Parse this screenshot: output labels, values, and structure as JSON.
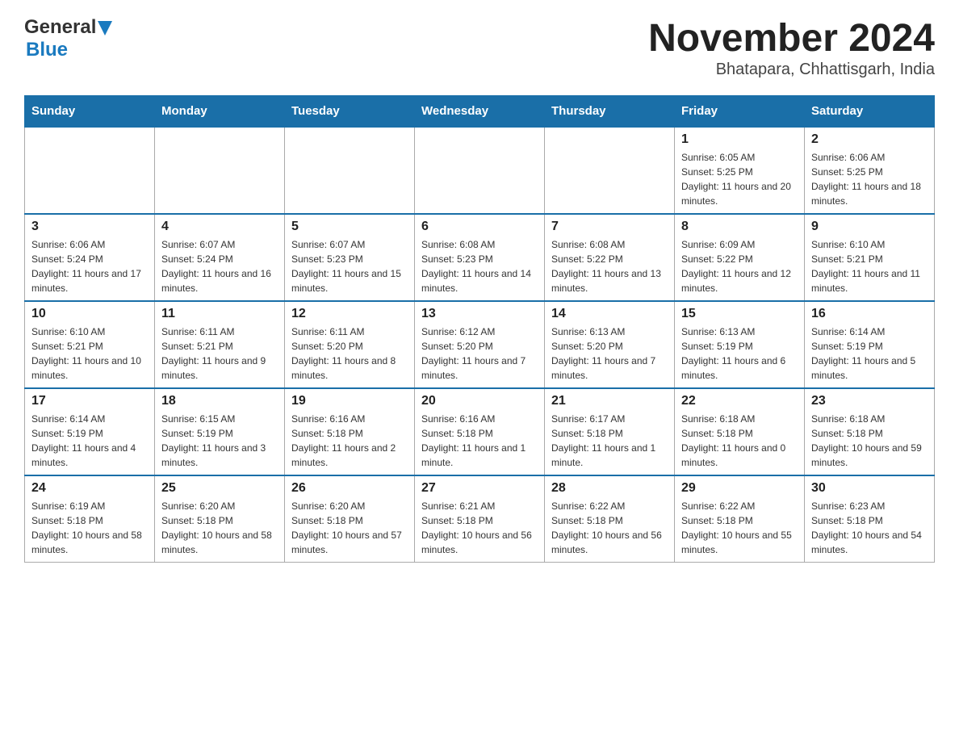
{
  "header": {
    "logo_general": "General",
    "logo_blue": "Blue",
    "month_title": "November 2024",
    "location": "Bhatapara, Chhattisgarh, India"
  },
  "days_of_week": [
    "Sunday",
    "Monday",
    "Tuesday",
    "Wednesday",
    "Thursday",
    "Friday",
    "Saturday"
  ],
  "weeks": [
    [
      {
        "day": "",
        "info": ""
      },
      {
        "day": "",
        "info": ""
      },
      {
        "day": "",
        "info": ""
      },
      {
        "day": "",
        "info": ""
      },
      {
        "day": "",
        "info": ""
      },
      {
        "day": "1",
        "info": "Sunrise: 6:05 AM\nSunset: 5:25 PM\nDaylight: 11 hours and 20 minutes."
      },
      {
        "day": "2",
        "info": "Sunrise: 6:06 AM\nSunset: 5:25 PM\nDaylight: 11 hours and 18 minutes."
      }
    ],
    [
      {
        "day": "3",
        "info": "Sunrise: 6:06 AM\nSunset: 5:24 PM\nDaylight: 11 hours and 17 minutes."
      },
      {
        "day": "4",
        "info": "Sunrise: 6:07 AM\nSunset: 5:24 PM\nDaylight: 11 hours and 16 minutes."
      },
      {
        "day": "5",
        "info": "Sunrise: 6:07 AM\nSunset: 5:23 PM\nDaylight: 11 hours and 15 minutes."
      },
      {
        "day": "6",
        "info": "Sunrise: 6:08 AM\nSunset: 5:23 PM\nDaylight: 11 hours and 14 minutes."
      },
      {
        "day": "7",
        "info": "Sunrise: 6:08 AM\nSunset: 5:22 PM\nDaylight: 11 hours and 13 minutes."
      },
      {
        "day": "8",
        "info": "Sunrise: 6:09 AM\nSunset: 5:22 PM\nDaylight: 11 hours and 12 minutes."
      },
      {
        "day": "9",
        "info": "Sunrise: 6:10 AM\nSunset: 5:21 PM\nDaylight: 11 hours and 11 minutes."
      }
    ],
    [
      {
        "day": "10",
        "info": "Sunrise: 6:10 AM\nSunset: 5:21 PM\nDaylight: 11 hours and 10 minutes."
      },
      {
        "day": "11",
        "info": "Sunrise: 6:11 AM\nSunset: 5:21 PM\nDaylight: 11 hours and 9 minutes."
      },
      {
        "day": "12",
        "info": "Sunrise: 6:11 AM\nSunset: 5:20 PM\nDaylight: 11 hours and 8 minutes."
      },
      {
        "day": "13",
        "info": "Sunrise: 6:12 AM\nSunset: 5:20 PM\nDaylight: 11 hours and 7 minutes."
      },
      {
        "day": "14",
        "info": "Sunrise: 6:13 AM\nSunset: 5:20 PM\nDaylight: 11 hours and 7 minutes."
      },
      {
        "day": "15",
        "info": "Sunrise: 6:13 AM\nSunset: 5:19 PM\nDaylight: 11 hours and 6 minutes."
      },
      {
        "day": "16",
        "info": "Sunrise: 6:14 AM\nSunset: 5:19 PM\nDaylight: 11 hours and 5 minutes."
      }
    ],
    [
      {
        "day": "17",
        "info": "Sunrise: 6:14 AM\nSunset: 5:19 PM\nDaylight: 11 hours and 4 minutes."
      },
      {
        "day": "18",
        "info": "Sunrise: 6:15 AM\nSunset: 5:19 PM\nDaylight: 11 hours and 3 minutes."
      },
      {
        "day": "19",
        "info": "Sunrise: 6:16 AM\nSunset: 5:18 PM\nDaylight: 11 hours and 2 minutes."
      },
      {
        "day": "20",
        "info": "Sunrise: 6:16 AM\nSunset: 5:18 PM\nDaylight: 11 hours and 1 minute."
      },
      {
        "day": "21",
        "info": "Sunrise: 6:17 AM\nSunset: 5:18 PM\nDaylight: 11 hours and 1 minute."
      },
      {
        "day": "22",
        "info": "Sunrise: 6:18 AM\nSunset: 5:18 PM\nDaylight: 11 hours and 0 minutes."
      },
      {
        "day": "23",
        "info": "Sunrise: 6:18 AM\nSunset: 5:18 PM\nDaylight: 10 hours and 59 minutes."
      }
    ],
    [
      {
        "day": "24",
        "info": "Sunrise: 6:19 AM\nSunset: 5:18 PM\nDaylight: 10 hours and 58 minutes."
      },
      {
        "day": "25",
        "info": "Sunrise: 6:20 AM\nSunset: 5:18 PM\nDaylight: 10 hours and 58 minutes."
      },
      {
        "day": "26",
        "info": "Sunrise: 6:20 AM\nSunset: 5:18 PM\nDaylight: 10 hours and 57 minutes."
      },
      {
        "day": "27",
        "info": "Sunrise: 6:21 AM\nSunset: 5:18 PM\nDaylight: 10 hours and 56 minutes."
      },
      {
        "day": "28",
        "info": "Sunrise: 6:22 AM\nSunset: 5:18 PM\nDaylight: 10 hours and 56 minutes."
      },
      {
        "day": "29",
        "info": "Sunrise: 6:22 AM\nSunset: 5:18 PM\nDaylight: 10 hours and 55 minutes."
      },
      {
        "day": "30",
        "info": "Sunrise: 6:23 AM\nSunset: 5:18 PM\nDaylight: 10 hours and 54 minutes."
      }
    ]
  ]
}
